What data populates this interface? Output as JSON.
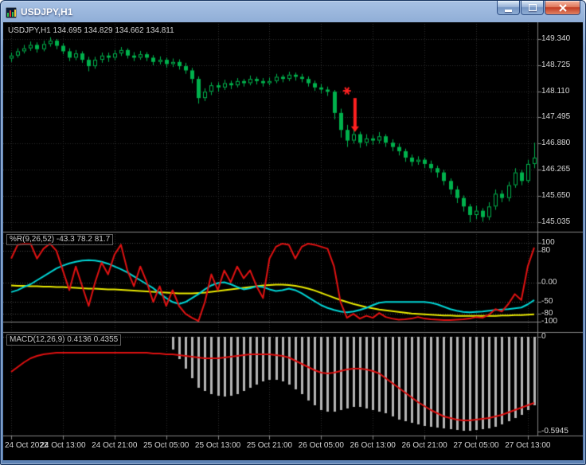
{
  "window": {
    "title": "USDJPY,H1"
  },
  "labels": {
    "info_line": "USDJPY,H1 134.695 134.829 134.662 134.811",
    "wpr": "%R(9,26,52) -43.3 78.2 81.7",
    "macd": "MACD(12,26,9) 0.4136 0.4355"
  },
  "colors": {
    "background": "#000000",
    "grid": "#2d2d2d",
    "separator": "#858585",
    "axis_text": "#d6d6d6",
    "candle": "#00b14c",
    "wpr_red": "#e01212",
    "wpr_cyan": "#00d4d4",
    "wpr_yellow": "#eaea00",
    "macd_histogram": "#b4b4b4",
    "macd_signal": "#dd1010",
    "annotation_red": "#ff2020",
    "window_accent": "#6d92c2"
  },
  "chart_data": {
    "type": "candlestick",
    "symbol": "USDJPY",
    "timeframe": "H1",
    "price_range": [
      144.9,
      149.62
    ],
    "price_axis_labels": [
      "149.340",
      "148.725",
      "148.110",
      "147.495",
      "146.880",
      "146.265",
      "145.650",
      "145.035"
    ],
    "time_axis": {
      "labels": [
        "24 Oct 2022",
        "24 Oct 13:00",
        "24 Oct 21:00",
        "25 Oct 05:00",
        "25 Oct 13:00",
        "25 Oct 21:00",
        "26 Oct 05:00",
        "26 Oct 13:00",
        "26 Oct 21:00",
        "27 Oct 05:00",
        "27 Oct 13:00"
      ],
      "bars": [
        0,
        8,
        16,
        24,
        32,
        40,
        48,
        56,
        64,
        72,
        80
      ]
    },
    "candles": [
      [
        148.88,
        149.02,
        148.8,
        148.95
      ],
      [
        148.95,
        149.12,
        148.9,
        149.05
      ],
      [
        149.05,
        149.2,
        149.0,
        149.12
      ],
      [
        149.12,
        149.28,
        149.06,
        149.2
      ],
      [
        149.2,
        149.26,
        149.02,
        149.1
      ],
      [
        149.1,
        149.3,
        149.05,
        149.22
      ],
      [
        149.22,
        149.38,
        149.16,
        149.3
      ],
      [
        149.3,
        149.34,
        149.1,
        149.18
      ],
      [
        149.18,
        149.24,
        148.98,
        149.05
      ],
      [
        149.05,
        149.12,
        148.82,
        148.9
      ],
      [
        148.9,
        149.08,
        148.84,
        149.0
      ],
      [
        149.0,
        149.05,
        148.78,
        148.85
      ],
      [
        148.85,
        148.92,
        148.58,
        148.7
      ],
      [
        148.7,
        148.92,
        148.64,
        148.85
      ],
      [
        148.85,
        149.02,
        148.78,
        148.95
      ],
      [
        148.95,
        149.02,
        148.8,
        148.9
      ],
      [
        148.9,
        149.08,
        148.84,
        149.0
      ],
      [
        149.0,
        149.15,
        148.94,
        149.08
      ],
      [
        149.08,
        149.12,
        148.88,
        148.95
      ],
      [
        148.95,
        149.03,
        148.82,
        148.9
      ],
      [
        148.9,
        149.06,
        148.85,
        148.98
      ],
      [
        148.98,
        149.03,
        148.82,
        148.9
      ],
      [
        148.9,
        148.96,
        148.72,
        148.8
      ],
      [
        148.8,
        148.93,
        148.74,
        148.85
      ],
      [
        148.85,
        148.9,
        148.66,
        148.75
      ],
      [
        148.75,
        148.88,
        148.68,
        148.8
      ],
      [
        148.8,
        148.86,
        148.62,
        148.7
      ],
      [
        148.7,
        148.78,
        148.52,
        148.6
      ],
      [
        148.6,
        148.66,
        148.3,
        148.4
      ],
      [
        148.4,
        148.46,
        147.82,
        147.95
      ],
      [
        147.95,
        148.18,
        147.88,
        148.1
      ],
      [
        148.1,
        148.32,
        148.02,
        148.25
      ],
      [
        148.25,
        148.32,
        148.1,
        148.2
      ],
      [
        148.2,
        148.38,
        148.14,
        148.3
      ],
      [
        148.3,
        148.36,
        148.16,
        148.25
      ],
      [
        148.25,
        148.42,
        148.2,
        148.35
      ],
      [
        148.35,
        148.4,
        148.22,
        148.3
      ],
      [
        148.3,
        148.48,
        148.25,
        148.4
      ],
      [
        148.4,
        148.45,
        148.27,
        148.35
      ],
      [
        148.35,
        148.42,
        148.22,
        148.3
      ],
      [
        148.3,
        148.43,
        148.25,
        148.35
      ],
      [
        148.35,
        148.52,
        148.3,
        148.45
      ],
      [
        148.45,
        148.5,
        148.32,
        148.4
      ],
      [
        148.4,
        148.57,
        148.35,
        148.5
      ],
      [
        148.5,
        148.55,
        148.36,
        148.45
      ],
      [
        148.45,
        148.52,
        148.32,
        148.4
      ],
      [
        148.4,
        148.46,
        148.22,
        148.3
      ],
      [
        148.3,
        148.36,
        148.12,
        148.2
      ],
      [
        148.2,
        148.28,
        148.06,
        148.15
      ],
      [
        148.15,
        148.22,
        148.0,
        148.1
      ],
      [
        148.1,
        148.14,
        147.45,
        147.6
      ],
      [
        147.6,
        147.7,
        147.02,
        147.2
      ],
      [
        147.2,
        147.32,
        146.8,
        146.95
      ],
      [
        146.95,
        147.22,
        146.88,
        147.1
      ],
      [
        147.1,
        147.16,
        146.78,
        146.9
      ],
      [
        146.9,
        147.1,
        146.82,
        147.0
      ],
      [
        147.0,
        147.08,
        146.85,
        146.95
      ],
      [
        146.95,
        147.15,
        146.88,
        147.05
      ],
      [
        147.05,
        147.1,
        146.8,
        146.9
      ],
      [
        146.9,
        146.98,
        146.7,
        146.8
      ],
      [
        146.8,
        146.88,
        146.6,
        146.7
      ],
      [
        146.7,
        146.76,
        146.45,
        146.55
      ],
      [
        146.55,
        146.62,
        146.35,
        146.45
      ],
      [
        146.45,
        146.58,
        146.38,
        146.5
      ],
      [
        146.5,
        146.55,
        146.3,
        146.4
      ],
      [
        146.4,
        146.48,
        146.2,
        146.3
      ],
      [
        146.3,
        146.36,
        146.08,
        146.2
      ],
      [
        146.2,
        146.26,
        145.9,
        146.0
      ],
      [
        146.0,
        146.06,
        145.68,
        145.8
      ],
      [
        145.8,
        145.88,
        145.48,
        145.6
      ],
      [
        145.6,
        145.66,
        145.28,
        145.4
      ],
      [
        145.4,
        145.46,
        145.03,
        145.2
      ],
      [
        145.2,
        145.42,
        145.1,
        145.3
      ],
      [
        145.3,
        145.36,
        145.04,
        145.15
      ],
      [
        145.15,
        145.5,
        145.08,
        145.4
      ],
      [
        145.4,
        145.8,
        145.32,
        145.7
      ],
      [
        145.7,
        145.78,
        145.5,
        145.6
      ],
      [
        145.6,
        145.98,
        145.52,
        145.9
      ],
      [
        145.9,
        146.3,
        145.84,
        146.2
      ],
      [
        146.2,
        146.26,
        145.9,
        146.0
      ],
      [
        146.0,
        146.5,
        145.95,
        146.4
      ],
      [
        146.4,
        146.9,
        146.3,
        146.55
      ]
    ],
    "annotation": {
      "type": "sell-signal",
      "star_bar": 52,
      "star_price": 148.12,
      "arrow_bar": 53,
      "arrow_from": 147.95,
      "arrow_to": 147.15
    },
    "wpr": {
      "range": [
        -120,
        120
      ],
      "axis_labels": [
        "100",
        "80",
        "0.00",
        "-50",
        "-80",
        "-100"
      ],
      "red": [
        60,
        95,
        98,
        98,
        60,
        85,
        98,
        80,
        30,
        -20,
        40,
        -10,
        -60,
        0,
        50,
        20,
        70,
        95,
        30,
        -10,
        40,
        0,
        -50,
        -10,
        -60,
        -20,
        -60,
        -80,
        -90,
        -98,
        -50,
        20,
        -20,
        30,
        0,
        40,
        10,
        30,
        -10,
        -40,
        60,
        90,
        98,
        95,
        60,
        90,
        98,
        95,
        90,
        85,
        40,
        -50,
        -90,
        -80,
        -92,
        -85,
        -90,
        -78,
        -88,
        -92,
        -95,
        -94,
        -92,
        -88,
        -92,
        -94,
        -95,
        -96,
        -96,
        -95,
        -94,
        -92,
        -88,
        -90,
        -82,
        -68,
        -74,
        -55,
        -30,
        -45,
        40,
        88
      ],
      "cyan": [
        -25,
        -20,
        -12,
        -5,
        5,
        15,
        25,
        35,
        42,
        48,
        52,
        55,
        56,
        55,
        52,
        47,
        40,
        33,
        25,
        15,
        5,
        -5,
        -15,
        -28,
        -40,
        -50,
        -55,
        -50,
        -40,
        -30,
        -18,
        -8,
        -2,
        0,
        -5,
        -12,
        -18,
        -15,
        -10,
        -12,
        -18,
        -22,
        -20,
        -16,
        -20,
        -28,
        -38,
        -48,
        -58,
        -65,
        -70,
        -74,
        -76,
        -74,
        -70,
        -65,
        -58,
        -52,
        -50,
        -50,
        -50,
        -50,
        -50,
        -50,
        -50,
        -52,
        -56,
        -62,
        -68,
        -72,
        -75,
        -76,
        -75,
        -74,
        -72,
        -70,
        -69,
        -68,
        -66,
        -64,
        -56,
        -45
      ],
      "yellow": [
        -8,
        -9,
        -9,
        -10,
        -10,
        -11,
        -11,
        -12,
        -12,
        -13,
        -14,
        -15,
        -16,
        -16,
        -17,
        -18,
        -18,
        -19,
        -20,
        -21,
        -22,
        -23,
        -24,
        -25,
        -26,
        -27,
        -28,
        -28,
        -28,
        -27,
        -26,
        -24,
        -22,
        -20,
        -18,
        -16,
        -14,
        -12,
        -10,
        -8,
        -7,
        -6,
        -6,
        -7,
        -9,
        -12,
        -16,
        -21,
        -27,
        -33,
        -39,
        -45,
        -50,
        -55,
        -59,
        -63,
        -66,
        -69,
        -71,
        -73,
        -75,
        -77,
        -79,
        -80,
        -81,
        -82,
        -83,
        -84,
        -84,
        -85,
        -85,
        -85,
        -85,
        -85,
        -85,
        -85,
        -84,
        -84,
        -83,
        -83,
        -82,
        -81
      ]
    },
    "macd": {
      "range": [
        -0.62,
        0.02
      ],
      "axis_labels": [
        "0",
        "-0.5945"
      ],
      "histogram_start": 25,
      "histogram": [
        -0.08,
        -0.14,
        -0.2,
        -0.26,
        -0.32,
        -0.34,
        -0.36,
        -0.37,
        -0.375,
        -0.37,
        -0.36,
        -0.34,
        -0.32,
        -0.3,
        -0.28,
        -0.27,
        -0.27,
        -0.28,
        -0.3,
        -0.33,
        -0.36,
        -0.4,
        -0.43,
        -0.46,
        -0.47,
        -0.47,
        -0.46,
        -0.45,
        -0.44,
        -0.44,
        -0.45,
        -0.46,
        -0.47,
        -0.48,
        -0.5,
        -0.52,
        -0.53,
        -0.54,
        -0.55,
        -0.56,
        -0.565,
        -0.57,
        -0.575,
        -0.58,
        -0.585,
        -0.59,
        -0.59,
        -0.585,
        -0.58,
        -0.575,
        -0.565,
        -0.55,
        -0.53,
        -0.51,
        -0.49,
        -0.46,
        -0.43
      ],
      "signal": [
        -0.22,
        -0.19,
        -0.16,
        -0.135,
        -0.12,
        -0.11,
        -0.105,
        -0.1,
        -0.1,
        -0.1,
        -0.1,
        -0.1,
        -0.1,
        -0.1,
        -0.1,
        -0.1,
        -0.1,
        -0.1,
        -0.1,
        -0.1,
        -0.1,
        -0.1,
        -0.105,
        -0.105,
        -0.11,
        -0.11,
        -0.115,
        -0.12,
        -0.125,
        -0.13,
        -0.135,
        -0.135,
        -0.135,
        -0.13,
        -0.125,
        -0.12,
        -0.115,
        -0.11,
        -0.11,
        -0.11,
        -0.11,
        -0.115,
        -0.12,
        -0.13,
        -0.15,
        -0.17,
        -0.19,
        -0.21,
        -0.225,
        -0.23,
        -0.225,
        -0.215,
        -0.205,
        -0.2,
        -0.2,
        -0.205,
        -0.215,
        -0.23,
        -0.26,
        -0.29,
        -0.32,
        -0.35,
        -0.38,
        -0.41,
        -0.435,
        -0.46,
        -0.48,
        -0.5,
        -0.51,
        -0.52,
        -0.525,
        -0.525,
        -0.52,
        -0.515,
        -0.51,
        -0.5,
        -0.49,
        -0.475,
        -0.46,
        -0.445,
        -0.43,
        -0.415
      ]
    }
  }
}
